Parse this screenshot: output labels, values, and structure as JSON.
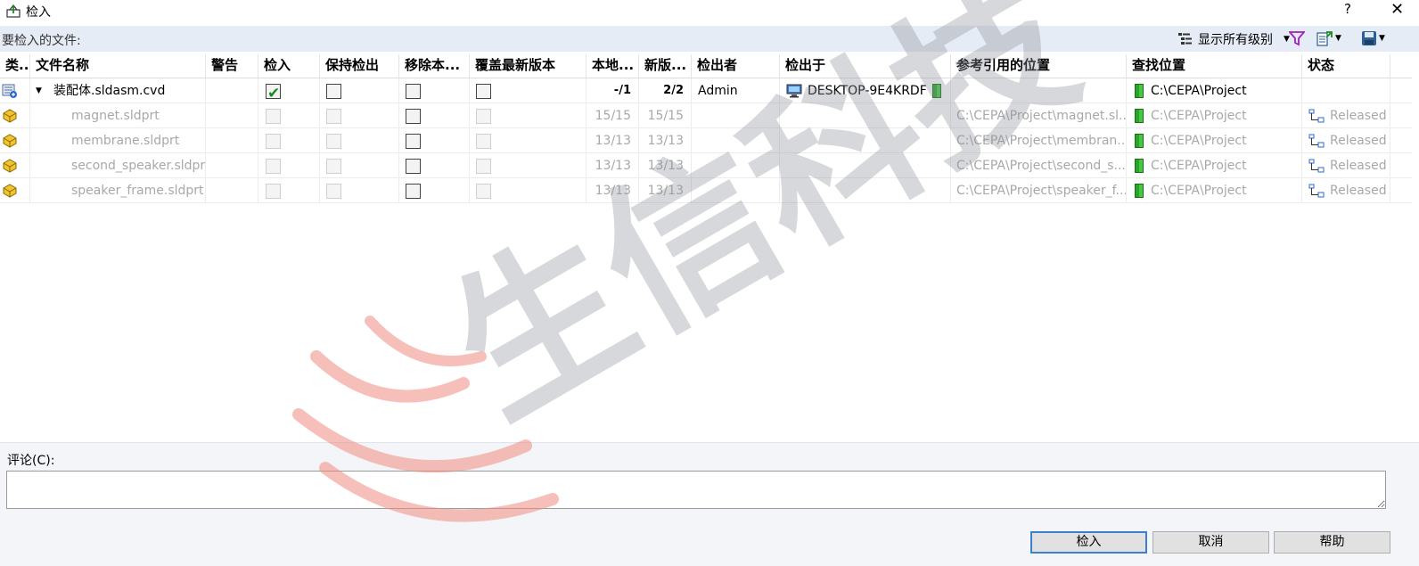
{
  "window": {
    "title": "检入",
    "help": "?",
    "close": "✕"
  },
  "toolbar": {
    "section_label": "要检入的文件:",
    "levels_label": "显示所有级别",
    "colors": {
      "bar_bg": "#e6ecf5",
      "filter": "#a020c0"
    }
  },
  "columns": [
    "类...",
    "文件名称",
    "警告",
    "检入",
    "保持检出",
    "移除本...",
    "覆盖最新版本",
    "本地...",
    "新版...",
    "检出者",
    "检出于",
    "参考引用的位置",
    "查找位置",
    "状态"
  ],
  "rows": [
    {
      "icon": "assembly-icon",
      "name": "装配体.sldasm.cvd",
      "expanded": true,
      "check_in": true,
      "local": "-/1",
      "new_version": "2/2",
      "checked_out_by": "Admin",
      "checked_out_on": "DESKTOP-9E4KRDF",
      "reference_location": "",
      "found_in": "C:\\CEPA\\Project",
      "status": ""
    },
    {
      "icon": "part-icon",
      "name": "magnet.sldprt",
      "local": "15/15",
      "new_version": "15/15",
      "reference_location": "C:\\CEPA\\Project\\magnet.sl...",
      "found_in": "C:\\CEPA\\Project",
      "status": "Released"
    },
    {
      "icon": "part-icon",
      "name": "membrane.sldprt",
      "local": "13/13",
      "new_version": "13/13",
      "reference_location": "C:\\CEPA\\Project\\membran...",
      "found_in": "C:\\CEPA\\Project",
      "status": "Released"
    },
    {
      "icon": "part-icon",
      "name": "second_speaker.sldprt",
      "local": "13/13",
      "new_version": "13/13",
      "reference_location": "C:\\CEPA\\Project\\second_s...",
      "found_in": "C:\\CEPA\\Project",
      "status": "Released"
    },
    {
      "icon": "part-icon",
      "name": "speaker_frame.sldprt",
      "local": "13/13",
      "new_version": "13/13",
      "reference_location": "C:\\CEPA\\Project\\speaker_f...",
      "found_in": "C:\\CEPA\\Project",
      "status": "Released"
    }
  ],
  "comment": {
    "label": "评论(C):",
    "value": ""
  },
  "buttons": {
    "check_in": "检入",
    "cancel": "取消",
    "help": "帮助"
  },
  "watermark": {
    "text": "生信科技"
  }
}
